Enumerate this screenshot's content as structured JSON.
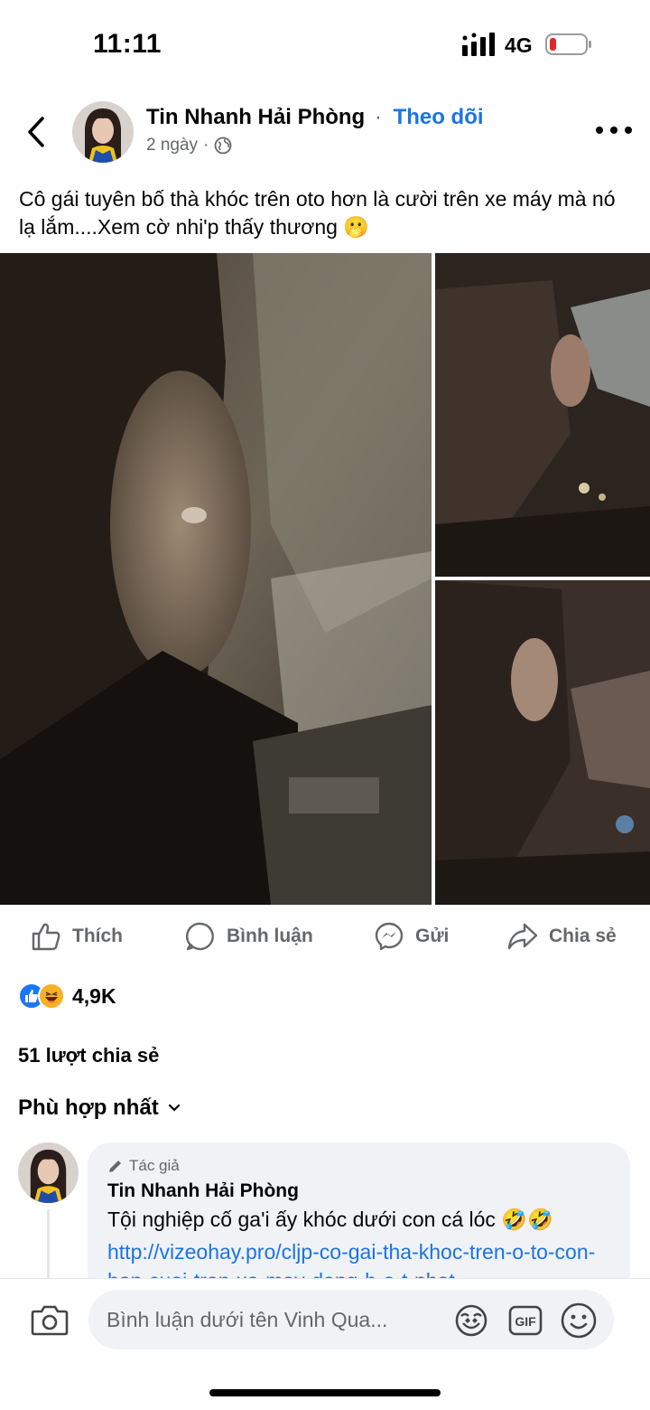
{
  "status_bar": {
    "time": "11:11",
    "network": "4G",
    "battery_color": "#e0282e"
  },
  "post": {
    "author": "Tin Nhanh Hải Phòng",
    "separator": "·",
    "follow_label": "Theo dõi",
    "time_ago": "2 ngày",
    "meta_separator": "·",
    "caption": "Cô gái tuyên bố thà khóc trên oto hơn là cười trên xe máy mà nó lạ lắm....Xem cờ nhi'p thấy thương 🫢"
  },
  "actions": {
    "like": "Thích",
    "comment": "Bình luận",
    "send": "Gửi",
    "share": "Chia sẻ"
  },
  "stats": {
    "reaction_count": "4,9K",
    "shares": "51 lượt chia sẻ"
  },
  "comments_sort": "Phù hợp nhất",
  "comment": {
    "badge": "Tác giả",
    "author": "Tin Nhanh Hải Phòng",
    "text": "Tội nghiệp cố ga'i ấy khóc dưới con cá lóc 🤣🤣",
    "link": "http://vizeohay.pro/cljp-co-gai-tha-khoc-tren-o-to-con-hon-cuoi-tren-xe-may-dang-h-o-t-nhat"
  },
  "composer": {
    "placeholder": "Bình luận dưới tên Vinh Qua..."
  },
  "colors": {
    "accent": "#1b74e4",
    "like_blue": "#1877f2",
    "haha_yellow": "#f7b125",
    "text_secondary": "#65676b",
    "bubble": "#f0f2f5"
  }
}
